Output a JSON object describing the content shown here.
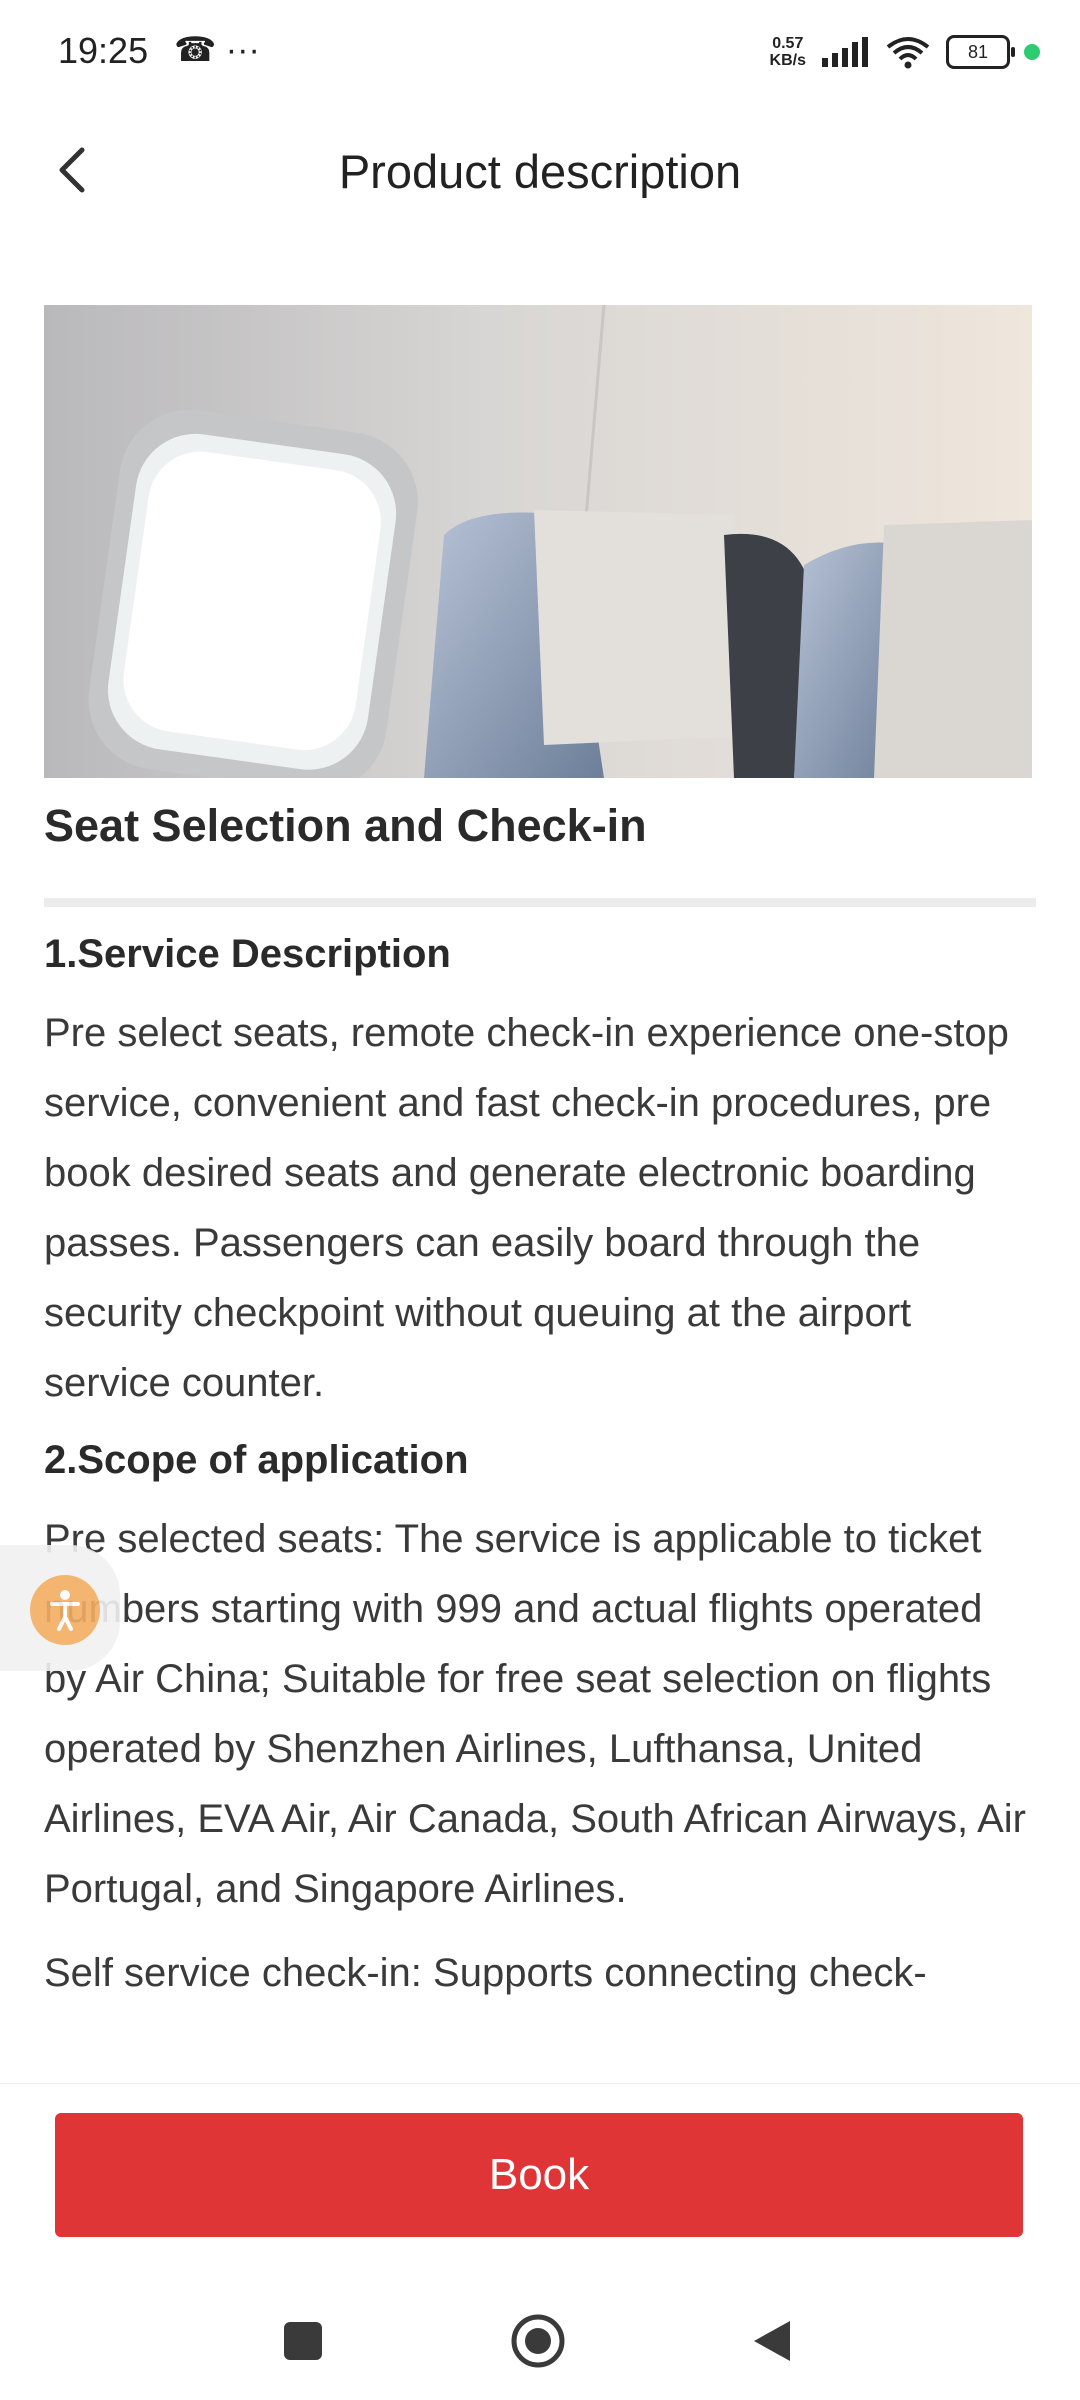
{
  "status_bar": {
    "time": "19:25",
    "left_icons": "☎ ···",
    "net_speed_value": "0.57",
    "net_speed_unit": "KB/s",
    "battery": "81"
  },
  "header": {
    "title": "Product description"
  },
  "product": {
    "name": "Seat Selection and Check-in"
  },
  "sections": [
    {
      "heading": "1.Service Description",
      "paragraphs": [
        "Pre select seats, remote check-in experience one-stop service, convenient and fast check-in procedures, pre book desired seats and generate electronic boarding passes. Passengers can easily board through the security checkpoint without queuing at the airport service counter."
      ]
    },
    {
      "heading": "2.Scope of application",
      "paragraphs": [
        "Pre selected seats: The service is applicable to ticket numbers starting with 999 and actual flights operated by Air China; Suitable for free seat selection on flights operated by Shenzhen Airlines, Lufthansa, United Airlines, EVA Air, Air Canada, South African Airways, Air Portugal, and Singapore Airlines.",
        "Self service check-in: Supports connecting check-"
      ]
    }
  ],
  "actions": {
    "book_label": "Book"
  },
  "colors": {
    "accent": "#e03537",
    "a11y": "#f4a34a",
    "status_dot": "#2ecc71"
  }
}
